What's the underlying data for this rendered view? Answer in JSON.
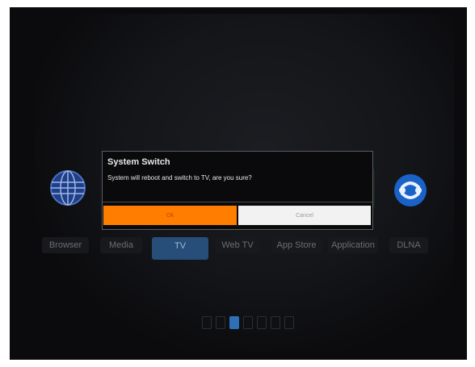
{
  "dock": {
    "apps": [
      {
        "label": "Browser"
      },
      {
        "label": "Media"
      },
      {
        "label": "TV"
      },
      {
        "label": "Web TV"
      },
      {
        "label": "App Store"
      },
      {
        "label": "Application"
      },
      {
        "label": "DLNA"
      }
    ],
    "selected_index": 2
  },
  "dialog": {
    "title": "System Switch",
    "message": "System will reboot and switch to TV, are you sure?",
    "ok_label": "Ok",
    "cancel_label": "Cancel"
  },
  "pager": {
    "page_count": 7,
    "current_page": 3
  },
  "colors": {
    "accent": "#ff7d00",
    "selection": "#264e78",
    "background": "#0b0b0d"
  }
}
